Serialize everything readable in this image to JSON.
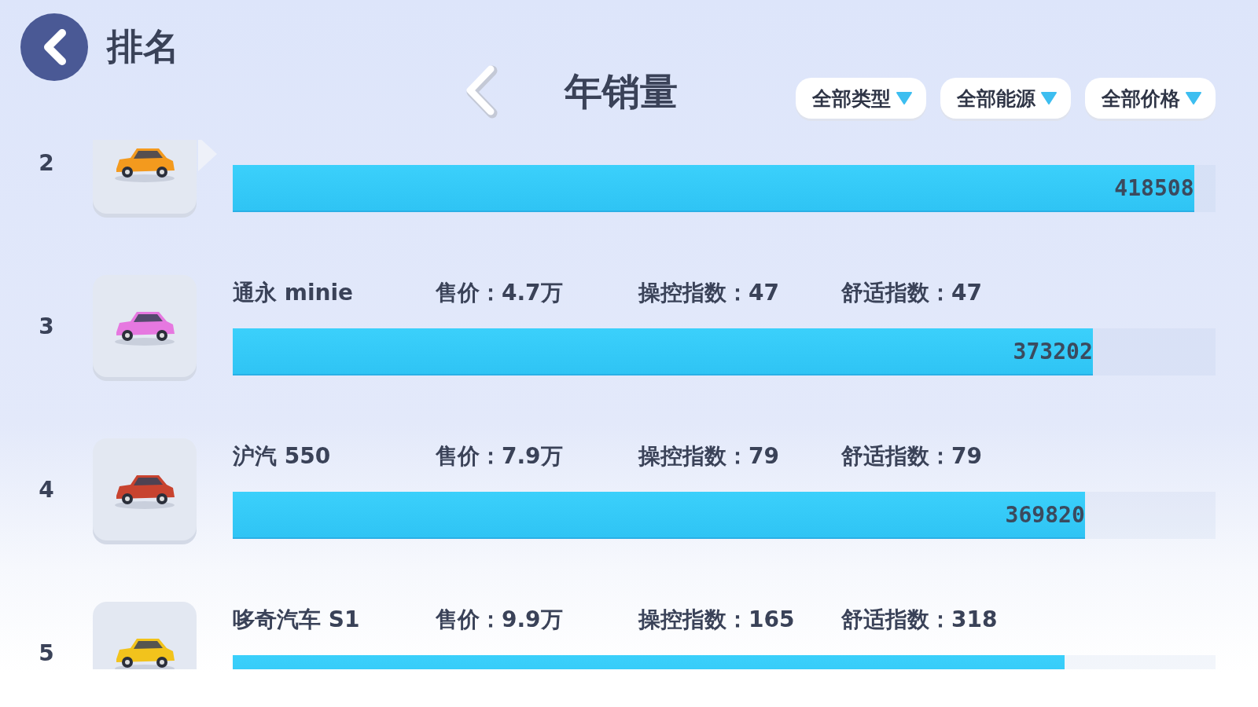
{
  "header": {
    "title": "排名",
    "chart_title": "年销量",
    "filters": [
      {
        "label": "全部类型"
      },
      {
        "label": "全部能源"
      },
      {
        "label": "全部价格"
      }
    ]
  },
  "rows": [
    {
      "rank": "2",
      "color": "#f39a1e",
      "selected": true,
      "value": "418508",
      "level": 0.978
    },
    {
      "rank": "3",
      "color": "#e678e0",
      "selected": false,
      "name": "通永 minie",
      "price": "售价：4.7万",
      "handling": "操控指数：47",
      "comfort": "舒适指数：47",
      "value": "373202",
      "level": 0.875
    },
    {
      "rank": "4",
      "color": "#c8432f",
      "selected": false,
      "name": "沪汽 550",
      "price": "售价：7.9万",
      "handling": "操控指数：79",
      "comfort": "舒适指数：79",
      "value": "369820",
      "level": 0.867
    },
    {
      "rank": "5",
      "color": "#f2c31c",
      "selected": false,
      "name": "哆奇汽车 S1",
      "price": "售价：9.9万",
      "handling": "操控指数：165",
      "comfort": "舒适指数：318",
      "value": "",
      "level": 0.846
    }
  ]
}
